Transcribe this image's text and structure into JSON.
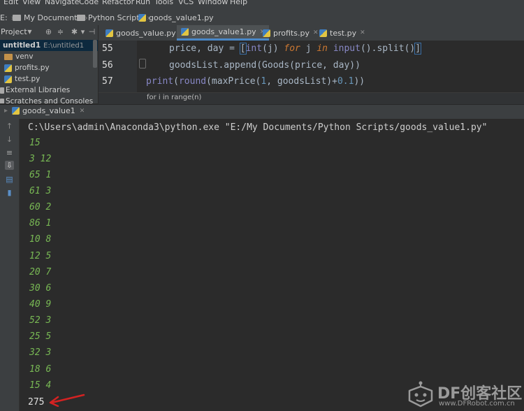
{
  "menu": [
    "Edit",
    "View",
    "Navigate",
    "Code",
    "Refactor",
    "Run",
    "Tools",
    "VCS",
    "Window",
    "Help"
  ],
  "breadcrumb": {
    "drive": "E:",
    "items": [
      "My Documents",
      "Python Scripts",
      "goods_value1.py"
    ]
  },
  "project": {
    "header_label": "Project",
    "tree": [
      {
        "label": "untitled1",
        "path": "E:\\untitled1"
      },
      {
        "label": "venv"
      },
      {
        "label": "profits.py"
      },
      {
        "label": "test.py"
      },
      {
        "label": "External Libraries"
      },
      {
        "label": "Scratches and Consoles"
      }
    ]
  },
  "tabs": [
    "goods_value.py",
    "goods_value1.py",
    "profits.py",
    "test.py"
  ],
  "active_tab": "goods_value1.py",
  "editor": {
    "line_numbers": [
      "55",
      "56",
      "57"
    ],
    "hint": "for i in range(n)"
  },
  "run": {
    "tab_label": "goods_value1",
    "command": "C:\\Users\\admin\\Anaconda3\\python.exe \"E:/My Documents/Python Scripts/goods_value1.py\"",
    "output_lines": [
      "15",
      "3 12",
      "65 1",
      "61 3",
      "60 2",
      "86 1",
      "10 8",
      "12 5",
      "20 7",
      "30 6",
      "40 9",
      "52 3",
      "25 5",
      "32 3",
      "18 6",
      "15 4"
    ],
    "result": "275"
  },
  "watermark": {
    "title": "DF创客社区",
    "url": "www.DFRobot.com.cn"
  },
  "colors": {
    "output_green": "#78b854",
    "keyword_orange": "#cc7832",
    "arrow_red": "#d32222"
  }
}
